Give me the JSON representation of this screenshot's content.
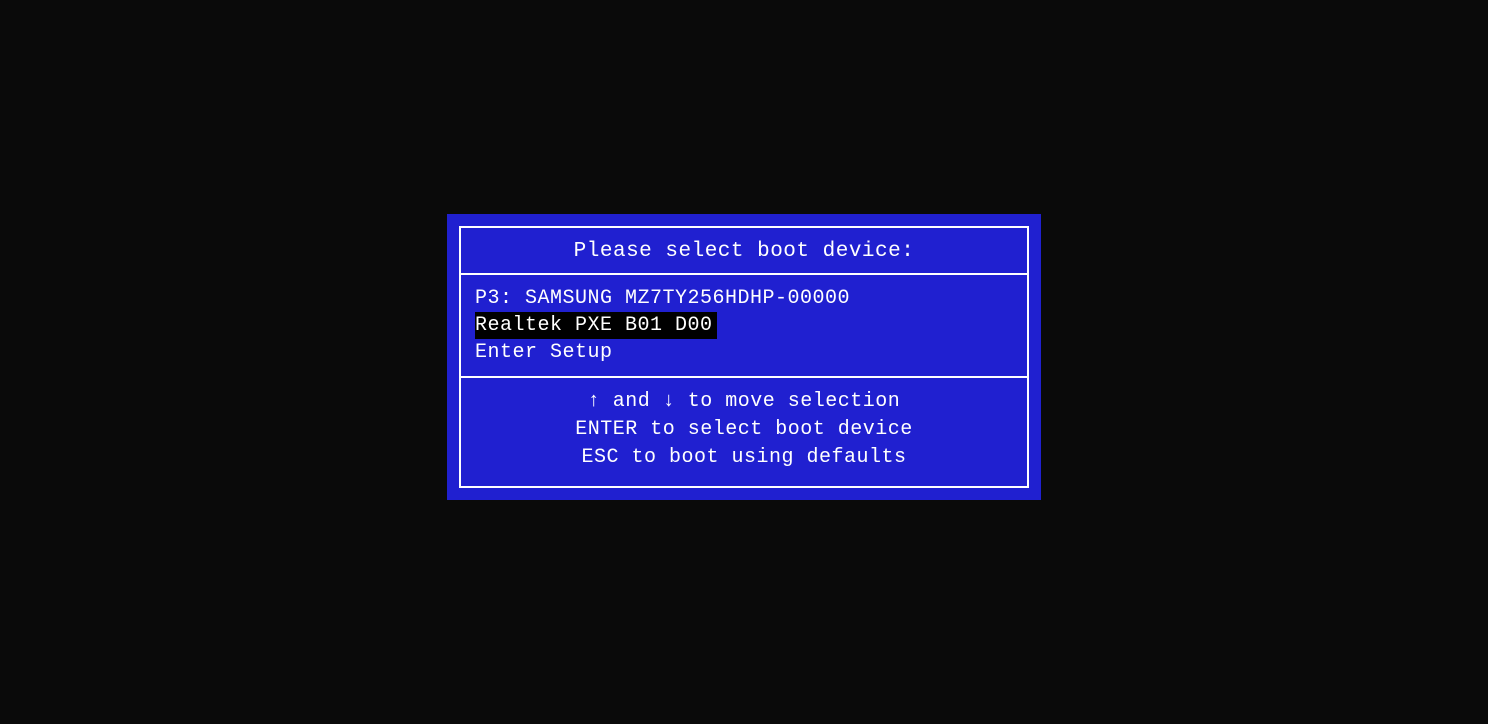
{
  "title": "Please select boot device:",
  "devices": [
    {
      "label": "P3: SAMSUNG MZ7TY256HDHP-00000",
      "selected": false
    },
    {
      "label": "Realtek PXE B01 D00",
      "selected": true
    },
    {
      "label": "Enter Setup",
      "selected": false
    }
  ],
  "footer": {
    "arrow_up": "↑",
    "and_text": " and ",
    "arrow_down": "↓",
    "move_text": " to move selection",
    "enter_line": "ENTER to select boot device",
    "esc_line": "ESC to boot using defaults"
  }
}
